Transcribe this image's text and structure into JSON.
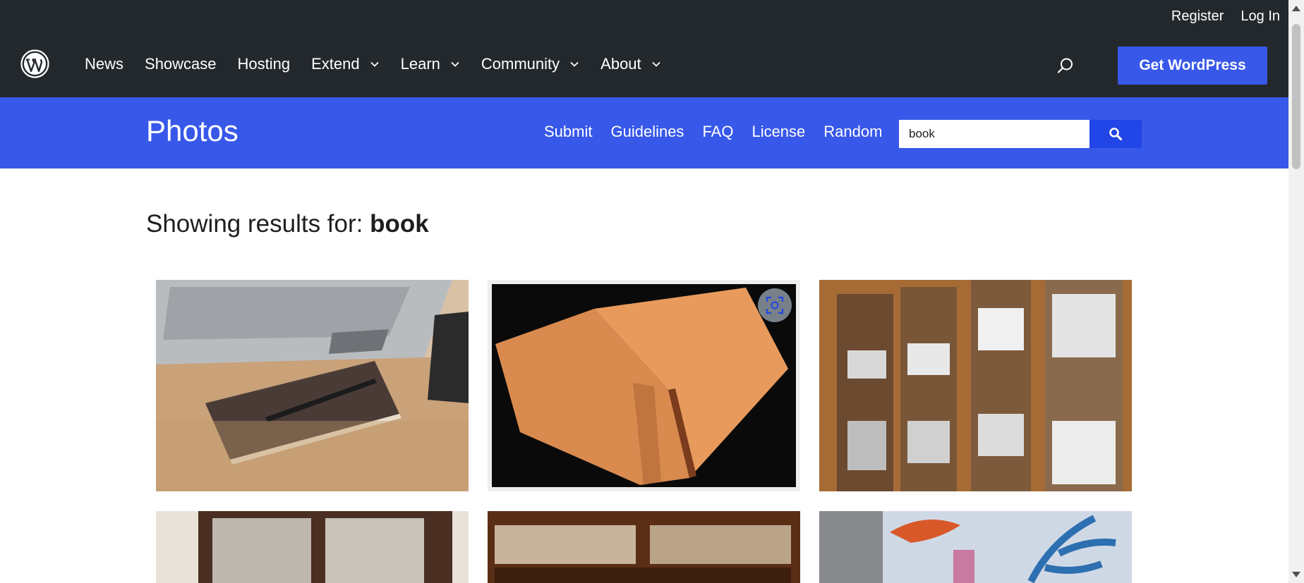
{
  "global_header": {
    "util_links": [
      "Register",
      "Log In"
    ],
    "nav": [
      {
        "label": "News",
        "dropdown": false
      },
      {
        "label": "Showcase",
        "dropdown": false
      },
      {
        "label": "Hosting",
        "dropdown": false
      },
      {
        "label": "Extend",
        "dropdown": true
      },
      {
        "label": "Learn",
        "dropdown": true
      },
      {
        "label": "Community",
        "dropdown": true
      },
      {
        "label": "About",
        "dropdown": true
      }
    ],
    "cta_label": "Get WordPress",
    "icons": [
      "wordpress-logo-icon",
      "search-icon",
      "chevron-down-icon"
    ]
  },
  "photos_header": {
    "title": "Photos",
    "nav": [
      "Submit",
      "Guidelines",
      "FAQ",
      "License",
      "Random"
    ],
    "search_value": "book"
  },
  "results": {
    "prefix": "Showing results for:",
    "query": "book",
    "photos": [
      "laptop-notebook-pen",
      "open-antique-book",
      "wooden-cabinets-with-papers",
      "wooden-glass-cabinet",
      "bookshelf-with-books",
      "painted-wall-mural"
    ]
  },
  "colors": {
    "global_header_bg": "#23282d",
    "brand_blue": "#3858e9",
    "search_button_bg": "#2145e6",
    "text": "#1e1e1e"
  }
}
